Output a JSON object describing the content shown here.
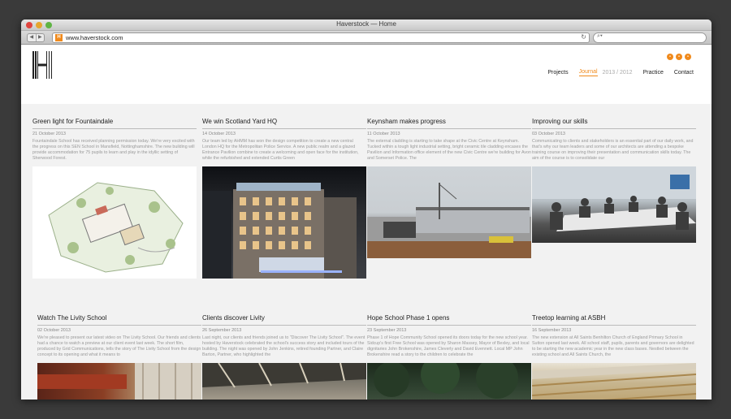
{
  "window": {
    "title": "Haverstock — Home"
  },
  "browser": {
    "url": "www.haverstock.com",
    "favicon": "H"
  },
  "site": {
    "nav": {
      "items": [
        "Projects",
        "Journal",
        "Practice",
        "Contact"
      ],
      "journal_years": "2013 / 2012"
    }
  },
  "posts": [
    {
      "title": "Green light for Fountaindale",
      "date": "21 October 2013",
      "excerpt": "Fountaindale School has received planning permission today. We're very excited with the progress on this SEN School in Mansfield, Nottinghamshire. The new building will provide accommodation for 75 pupils to learn and play in the idyllic setting of Sherwood Forest."
    },
    {
      "title": "We win Scotland Yard HQ",
      "date": "14 October 2013",
      "excerpt": "Our team led by AHMM has won the design competition to create a new central London HQ for the Metropolitan Police Service. A new public realm and a glazed Entrance Pavilion combine to create a welcoming and open face for the institution, while the refurbished and extended Curtis Green"
    },
    {
      "title": "Keynsham makes progress",
      "date": "11 October 2013",
      "excerpt": "The external cladding is starting to take shape at the Civic Centre at Keynsham. Tucked within a tough light industrial setting, bright ceramic tile cladding encases the Pavilion and Information office element of the new Civic Centre we're building for Avon and Somerset Police. The"
    },
    {
      "title": "Improving our skills",
      "date": "03 October 2013",
      "excerpt": "Communicating to clients and stakeholders is an essential part of our daily work, and that's why our team leaders and some of our architects are attending a bespoke training course on improving their presentation and communication skills today. The aim of the course is to consolidate our"
    },
    {
      "title": "Watch The Livity School",
      "date": "02 October 2013",
      "excerpt": "We're pleased to present our latest video on The Livity School. Our friends and clients had a chance to watch a preview at our client event last week. The short film, produced by Grid Communications, tells the story of The Livity School from the design concept to its opening and what it means to"
    },
    {
      "title": "Clients discover Livity",
      "date": "26 September 2013",
      "excerpt": "Last night, our clients and friends joined us to \"Discover The Livity School\". The event hosted by Haverstock celebrated the school's success story and included tours of the building. The night was opened by John Jenkins, retired founding Partner, and Claire Barton, Partner, who highlighted the"
    },
    {
      "title": "Hope School Phase 1 opens",
      "date": "23 September 2013",
      "excerpt": "Phase 1 of Hope Community School opened its doors today for the new school year. Sidcup's first Free School was opened by Sharon Massey, Mayor of Bexley, and local dignitaries John Brokenshire, James Cleverly and David Evennett. Local MP John Brokenshire read a story to the children to celebrate the"
    },
    {
      "title": "Treetop learning at ASBH",
      "date": "16 September 2013",
      "excerpt": "The new extension at All Saints Benhilton Church of England Primary School in Sutton opened last week. All school staff, pupils, parents and governors are delighted to be starting the new academic year in the new class bases. Nestled between the existing school and All Saints Church, the"
    }
  ],
  "icons": {
    "back": "left-arrow-icon",
    "forward": "right-arrow-icon",
    "reload": "reload-icon",
    "search": "search-icon",
    "social": [
      "rss-icon",
      "twitter-icon",
      "email-icon"
    ]
  },
  "colors": {
    "accent": "#f08a1c",
    "page_bg": "#f2f2f2",
    "header_bg": "#ffffff"
  }
}
